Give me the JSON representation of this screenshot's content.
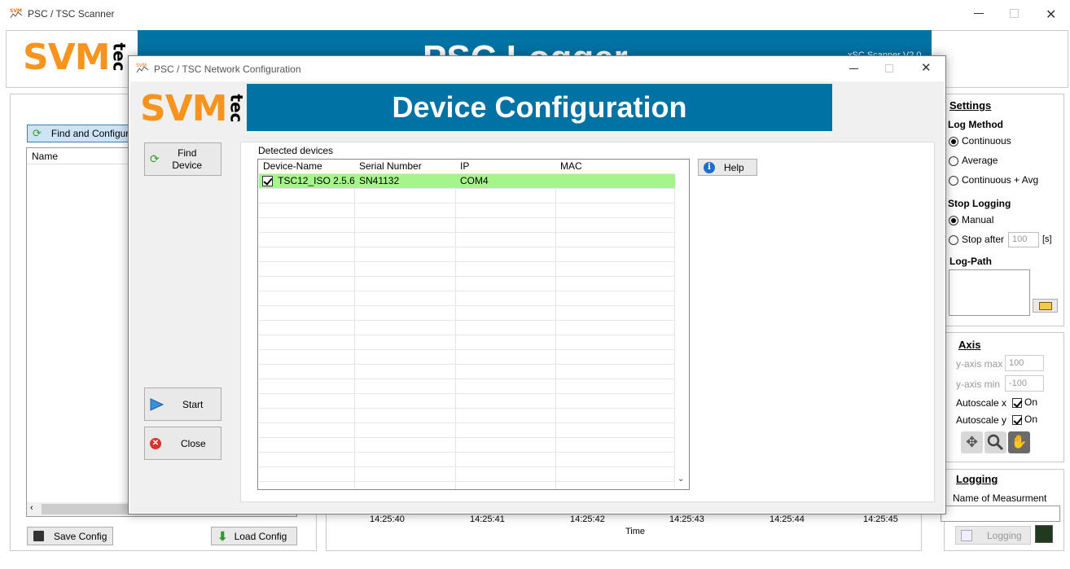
{
  "main_window": {
    "title": "PSC / TSC Scanner",
    "banner_title": "PSC Logger",
    "banner_version": "xSC Scanner V2.0",
    "find_button": "Find and Configure",
    "name_header": "Name",
    "save_config": "Save Config",
    "load_config": "Load Config",
    "time_ticks": [
      "14:25:40",
      "14:25:41",
      "14:25:42",
      "14:25:43",
      "14:25:44",
      "14:25:45"
    ],
    "time_label": "Time"
  },
  "settings": {
    "title": "Settings",
    "log_method_label": "Log Method",
    "log_method_options": [
      "Continuous",
      "Average",
      "Continuous + Avg"
    ],
    "log_method_selected": "Continuous",
    "stop_logging_label": "Stop Logging",
    "stop_manual": "Manual",
    "stop_after": "Stop after",
    "stop_after_value": "100",
    "stop_after_unit": "[s]",
    "log_path_label": "Log-Path"
  },
  "axis": {
    "title": "Axis",
    "ymax_label": "y-axis max",
    "ymax_value": "100",
    "ymin_label": "y-axis min",
    "ymin_value": "-100",
    "autoscale_x_label": "Autoscale x",
    "autoscale_x_value": "On",
    "autoscale_y_label": "Autoscale y",
    "autoscale_y_value": "On"
  },
  "logging": {
    "title": "Logging",
    "name_label": "Name of Measurment",
    "logging_button": "Logging"
  },
  "dialog": {
    "title": "PSC / TSC Network Configuration",
    "header": "Device Configuration",
    "find_device": "Find Device",
    "start": "Start",
    "close": "Close",
    "help": "Help",
    "detected_label": "Detected devices",
    "columns": [
      "Device-Name",
      "Serial Number",
      "IP",
      "MAC"
    ],
    "rows": [
      {
        "device_name": "TSC12_ISO 2.5.6",
        "serial": "SN41132",
        "ip": "COM4",
        "mac": "",
        "checked": true
      }
    ]
  },
  "logo": {
    "svm": "SVM",
    "tec": "tec"
  },
  "colors": {
    "banner": "#0072a3",
    "logo_orange": "#f7941d",
    "row_selected": "#a6f58a"
  },
  "icons": [
    "refresh-icon",
    "play-icon",
    "close-circle-icon",
    "info-icon",
    "folder-icon",
    "save-icon",
    "download-icon",
    "move-icon",
    "zoom-icon",
    "hand-icon"
  ]
}
